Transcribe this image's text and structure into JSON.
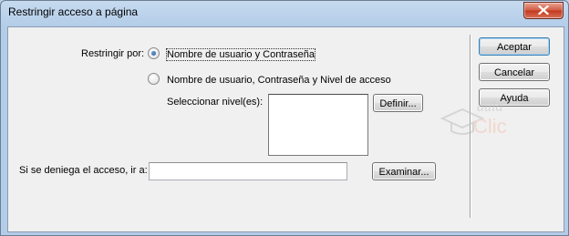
{
  "window": {
    "title": "Restringir acceso a página",
    "close_icon": "close-icon"
  },
  "restrict": {
    "label": "Restringir por:",
    "options": [
      {
        "label": "Nombre de usuario y Contraseña",
        "checked": true
      },
      {
        "label": "Nombre de usuario, Contraseña y Nivel de acceso",
        "checked": false
      }
    ],
    "levels_label": "Seleccionar nivel(es):",
    "levels": [],
    "define_button": "Definir..."
  },
  "deny": {
    "label": "Si se deniega el acceso, ir a:",
    "value": "",
    "browse_button": "Examinar..."
  },
  "actions": {
    "accept": "Aceptar",
    "cancel": "Cancelar",
    "help": "Ayuda"
  },
  "watermark": {
    "line1": "aula",
    "line2": "Clic"
  }
}
